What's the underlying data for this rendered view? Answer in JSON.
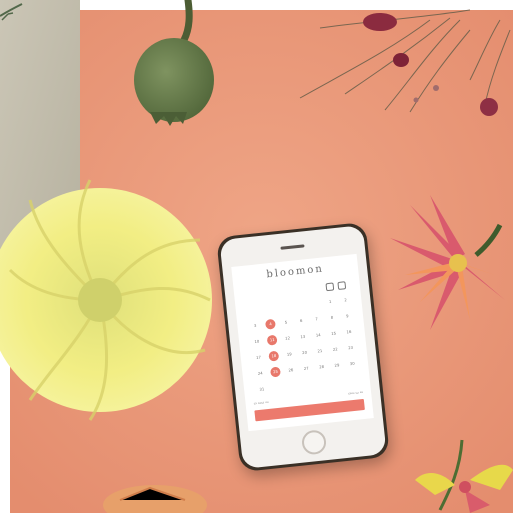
{
  "scene": {
    "description_colors": {
      "tabletop": "#e9967a",
      "accent_coral": "#ec7a6d",
      "chrysanthemum": "#f2ec73",
      "panel": "#c4bfaf"
    }
  },
  "phone_app": {
    "brand": "bloomon",
    "calendar_days": [
      "",
      "",
      "",
      "",
      "",
      "1",
      "2",
      "3",
      "4",
      "5",
      "6",
      "7",
      "8",
      "9",
      "10",
      "11",
      "12",
      "13",
      "14",
      "15",
      "16",
      "17",
      "18",
      "19",
      "20",
      "21",
      "22",
      "23",
      "24",
      "25",
      "26",
      "27",
      "28",
      "29",
      "30",
      "31",
      ""
    ],
    "selected_days": [
      "4",
      "11",
      "18",
      "25"
    ],
    "cta_label": ""
  }
}
